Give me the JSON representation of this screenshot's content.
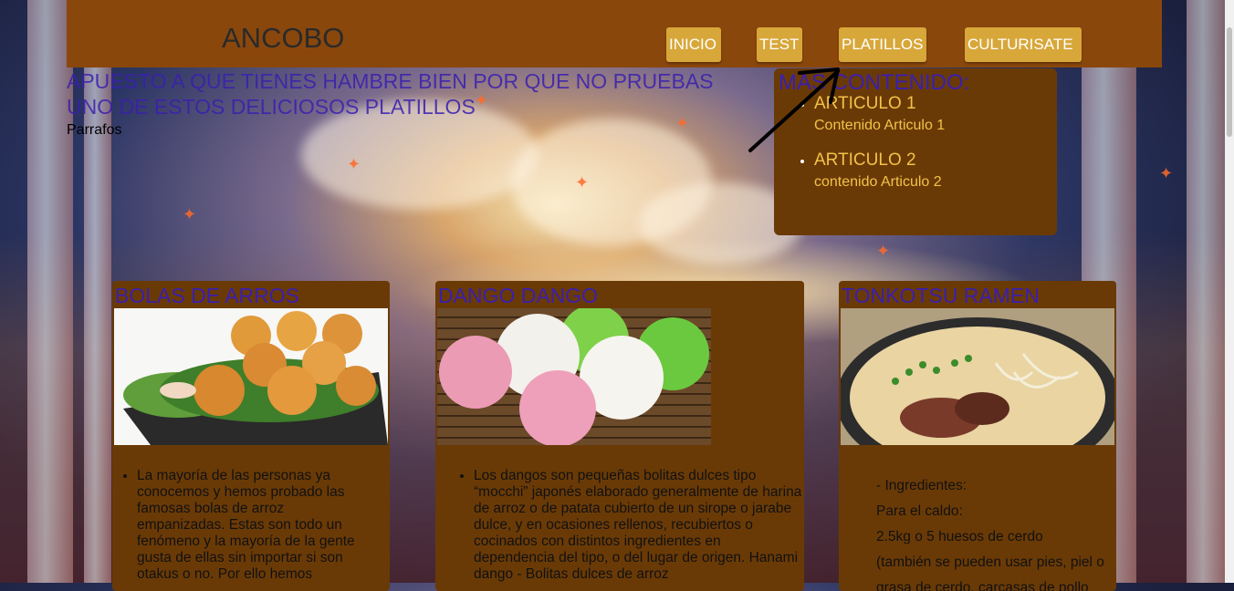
{
  "brand": "ANCOBO",
  "nav": [
    {
      "label": "INICIO"
    },
    {
      "label": "TEST"
    },
    {
      "label": "PLATILLOS"
    },
    {
      "label": "CULTURISATE"
    }
  ],
  "hero": {
    "title": "APUESTO A QUE TIENES HAMBRE BIEN POR QUE NO PRUEBAS UNO DE ESTOS DELICIOSOS PLATILLOS",
    "subtitle": "Parrafos"
  },
  "sidebar": {
    "title": "MAS CONTENIDO:",
    "articles": [
      {
        "title": "ARTICULO 1",
        "body": "Contenido Articulo 1"
      },
      {
        "title": "ARTICULO 2",
        "body": "contenido Articulo 2"
      }
    ]
  },
  "cards": [
    {
      "title": "BOLAS DE ARROS",
      "image": "fried-rice-balls-photo",
      "text": "La mayoría de las personas ya conocemos y hemos probado las famosas bolas de arroz empanizadas. Estas son todo un fenómeno y la mayoría de la gente gusta de ellas sin importar si son otakus o no. Por ello hemos"
    },
    {
      "title": "DANGO DANGO",
      "image": "dango-photo",
      "text": "Los dangos son pequeñas bolitas dulces tipo “mocchi” japonés elaborado generalmente de harina de arroz o de patata cubierto de un sirope o jarabe dulce, y en ocasiones rellenos, recubiertos o cocinados con distintos ingredientes en dependencia del tipo, o del lugar de origen. Hanami dango - Bolitas dulces de arroz"
    },
    {
      "title": "TONKOTSU RAMEN",
      "image": "ramen-photo",
      "lines": [
        "- Ingredientes:",
        "Para el caldo:",
        "2.5kg o 5 huesos de cerdo",
        "(también se pueden usar pies, piel o",
        "grasa de cerdo, carcasas de pollo"
      ]
    }
  ],
  "colors": {
    "navbar": "#8a470c",
    "button": "#d8a73a",
    "card": "#6a3a06",
    "heading": "#3a1fb0",
    "accent": "#f2c24a"
  }
}
